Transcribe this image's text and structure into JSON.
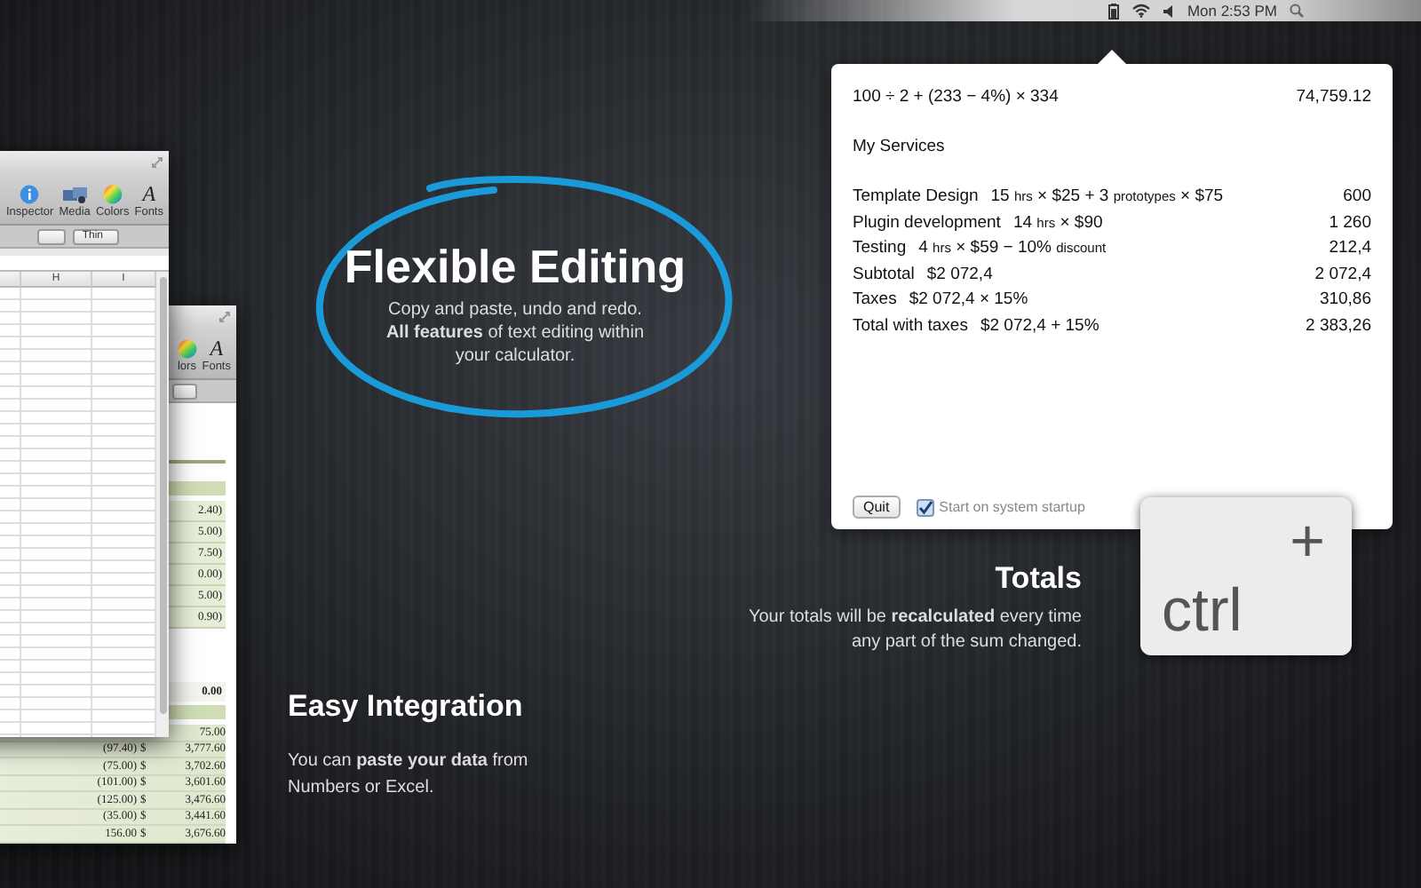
{
  "menu_bar": {
    "clock": "Mon 2:53 PM"
  },
  "spreadsheets": [
    {
      "toolbar": [
        {
          "kind": "info",
          "label": "Inspector"
        },
        {
          "kind": "media",
          "label": "Media"
        },
        {
          "kind": "colors",
          "label": "Colors"
        },
        {
          "kind": "fonts",
          "glyph": "A",
          "label": "Fonts"
        }
      ],
      "border_style": "Thin",
      "columns": [
        "H",
        "I"
      ]
    },
    {
      "toolbar": [
        {
          "kind": "colors",
          "label": "lors"
        },
        {
          "kind": "fonts",
          "glyph": "A",
          "label": "Fonts"
        }
      ],
      "upper_values": [
        "2.40)",
        "5.00)",
        "7.50)",
        "0.00)",
        "5.00)",
        "0.90)"
      ],
      "total": "0.00",
      "lower_rows": [
        {
          "balance": "75.00"
        },
        {
          "amount": "(97.40)",
          "currency": "$",
          "balance": "3,777.60"
        },
        {
          "amount": "(75.00)",
          "currency": "$",
          "balance": "3,702.60"
        },
        {
          "amount": "(101.00)",
          "currency": "$",
          "balance": "3,601.60"
        },
        {
          "amount": "(125.00)",
          "currency": "$",
          "balance": "3,476.60"
        },
        {
          "amount": "(35.00)",
          "currency": "$",
          "balance": "3,441.60"
        },
        {
          "amount": "156.00",
          "currency": "$",
          "balance": "3,676.60"
        }
      ]
    }
  ],
  "calculator": {
    "lines": [
      {
        "kind": "expression",
        "parts": [
          {
            "kind": "term",
            "text": "100 ÷ 2 + (233 − 4%) × 334"
          }
        ],
        "result": "74,759.12"
      },
      {
        "kind": "heading",
        "label": "My Services"
      },
      {
        "kind": "item",
        "label": "Template Design",
        "parts": [
          {
            "kind": "term",
            "text": "15"
          },
          {
            "kind": "unit",
            "text": "hrs"
          },
          {
            "kind": "term",
            "text": "× $25 + 3"
          },
          {
            "kind": "unit",
            "text": "prototypes"
          },
          {
            "kind": "term",
            "text": "× $75"
          }
        ],
        "result": "600"
      },
      {
        "kind": "item",
        "label": "Plugin development",
        "parts": [
          {
            "kind": "term",
            "text": "14"
          },
          {
            "kind": "unit",
            "text": "hrs"
          },
          {
            "kind": "term",
            "text": "× $90"
          }
        ],
        "result": "1 260"
      },
      {
        "kind": "item",
        "label": "Testing",
        "parts": [
          {
            "kind": "term",
            "text": "4"
          },
          {
            "kind": "unit",
            "text": "hrs"
          },
          {
            "kind": "term",
            "text": "× $59 − 10%"
          },
          {
            "kind": "unit",
            "text": "discount"
          }
        ],
        "result": "212,4"
      },
      {
        "kind": "item",
        "label": "Subtotal",
        "parts": [
          {
            "kind": "term",
            "text": "$2 072,4"
          }
        ],
        "result": "2 072,4"
      },
      {
        "kind": "item",
        "label": "Taxes",
        "parts": [
          {
            "kind": "term",
            "text": "$2 072,4 × 15%"
          }
        ],
        "result": "310,86"
      },
      {
        "kind": "item",
        "label": "Total with taxes",
        "parts": [
          {
            "kind": "term",
            "text": "$2 072,4 + 15%"
          }
        ],
        "result": "2 383,26"
      }
    ],
    "quit_button": "Quit",
    "startup": {
      "label": "Start on system startup",
      "checked": true
    }
  },
  "shortcut_key": {
    "symbol": "+",
    "label": "ctrl"
  },
  "features": [
    {
      "kind": "ring",
      "title": "Flexible Editing",
      "text": "Copy and paste, undo and redo.\n**All features** of text editing within\nyour calculator."
    },
    {
      "kind": "right",
      "title": "Totals",
      "text": "Your totals will be **recalculated** every time\nany part of the sum changed."
    },
    {
      "kind": "left",
      "title": "Easy Integration",
      "text": "You can **paste your data** from\nNumbers or Excel."
    }
  ]
}
